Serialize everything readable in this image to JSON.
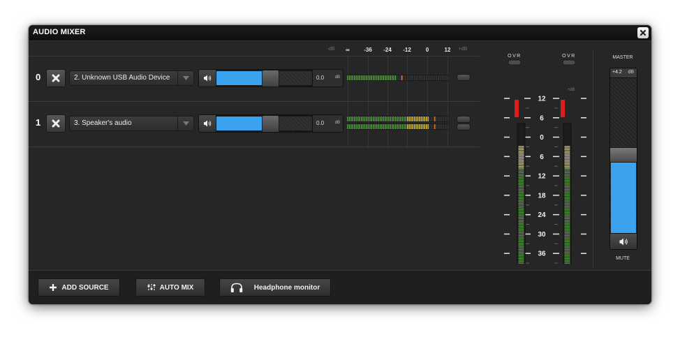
{
  "window": {
    "title": "AUDIO MIXER"
  },
  "scale": {
    "unit_low": "-dB",
    "unit_high": "+dB",
    "ticks": [
      "∞",
      "-36",
      "-24",
      "-12",
      "0",
      "12"
    ]
  },
  "channels": [
    {
      "index": "0",
      "device": "2. Unknown USB Audio Device",
      "volume": "0.0",
      "volume_unit": "dB",
      "volume_fraction": 0.5,
      "level_fraction": 0.48
    },
    {
      "index": "1",
      "device": "3. Speaker's audio",
      "volume": "0.0",
      "volume_unit": "dB",
      "volume_fraction": 0.5,
      "level_fraction": 0.8
    }
  ],
  "master_meter": {
    "ovr_label": "OVR",
    "plus_db": "+dB",
    "minus_db": "−dB",
    "scale": [
      "12",
      "6",
      "0",
      "6",
      "12",
      "18",
      "24",
      "30",
      "36",
      "∞"
    ],
    "level_fraction": 0.86
  },
  "master": {
    "label": "MASTER",
    "value": "+4.2",
    "unit": "dB",
    "level_fraction": 0.5,
    "mute_label": "MUTE"
  },
  "toolbar": {
    "add_source": "ADD SOURCE",
    "auto_mix": "AUTO MIX",
    "headphone": "Headphone monitor"
  },
  "colors": {
    "accent": "#3aa2ef",
    "meter_green": "#5fa64a",
    "meter_yellow": "#e8d44a",
    "peak_red": "#e21c1c"
  }
}
